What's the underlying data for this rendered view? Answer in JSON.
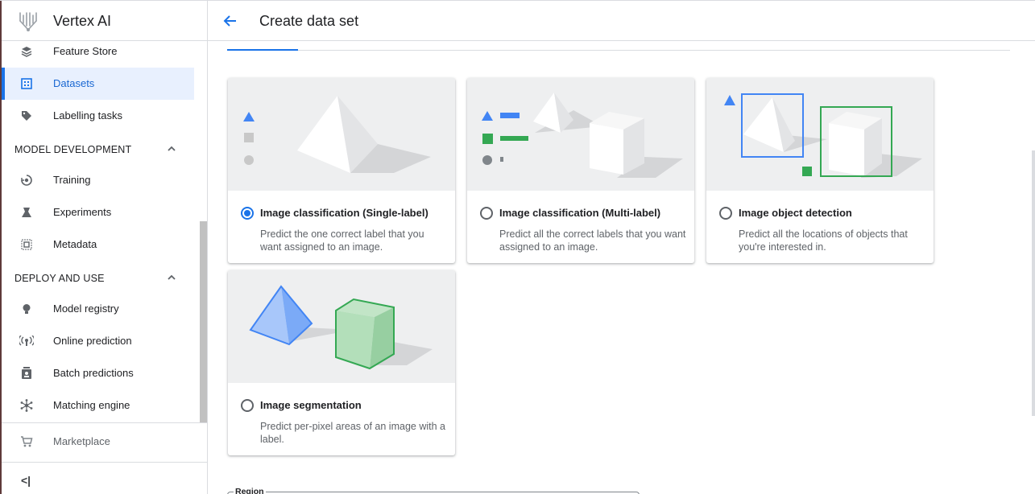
{
  "app": {
    "name": "Vertex AI"
  },
  "sidebar": {
    "items_top": [
      {
        "label": "Feature Store",
        "icon": "feature-store-icon"
      },
      {
        "label": "Datasets",
        "icon": "datasets-icon",
        "active": true
      },
      {
        "label": "Labelling tasks",
        "icon": "label-tag-icon"
      }
    ],
    "sections": [
      {
        "title": "MODEL DEVELOPMENT",
        "items": [
          {
            "label": "Training",
            "icon": "training-icon"
          },
          {
            "label": "Experiments",
            "icon": "flask-icon"
          },
          {
            "label": "Metadata",
            "icon": "metadata-icon"
          }
        ]
      },
      {
        "title": "DEPLOY AND USE",
        "items": [
          {
            "label": "Model registry",
            "icon": "lightbulb-icon"
          },
          {
            "label": "Online prediction",
            "icon": "broadcast-icon"
          },
          {
            "label": "Batch predictions",
            "icon": "batch-icon"
          },
          {
            "label": "Matching engine",
            "icon": "hub-icon"
          }
        ]
      }
    ],
    "marketplace": {
      "label": "Marketplace",
      "icon": "cart-icon"
    },
    "collapse_label": "<|"
  },
  "header": {
    "title": "Create data set"
  },
  "cards": [
    {
      "title": "Image classification (Single-label)",
      "desc": "Predict the one correct label that you want assigned to an image.",
      "selected": true
    },
    {
      "title": "Image classification (Multi-label)",
      "desc": "Predict all the correct labels that you want assigned to an image.",
      "selected": false
    },
    {
      "title": "Image object detection",
      "desc": "Predict all the locations of objects that you're interested in.",
      "selected": false
    },
    {
      "title": "Image segmentation",
      "desc": "Predict per-pixel areas of an image with a label.",
      "selected": false
    }
  ],
  "region": {
    "label": "Region"
  },
  "colors": {
    "accent": "#1a73e8",
    "green": "#34a853",
    "active_bg": "#e8f0fe"
  }
}
